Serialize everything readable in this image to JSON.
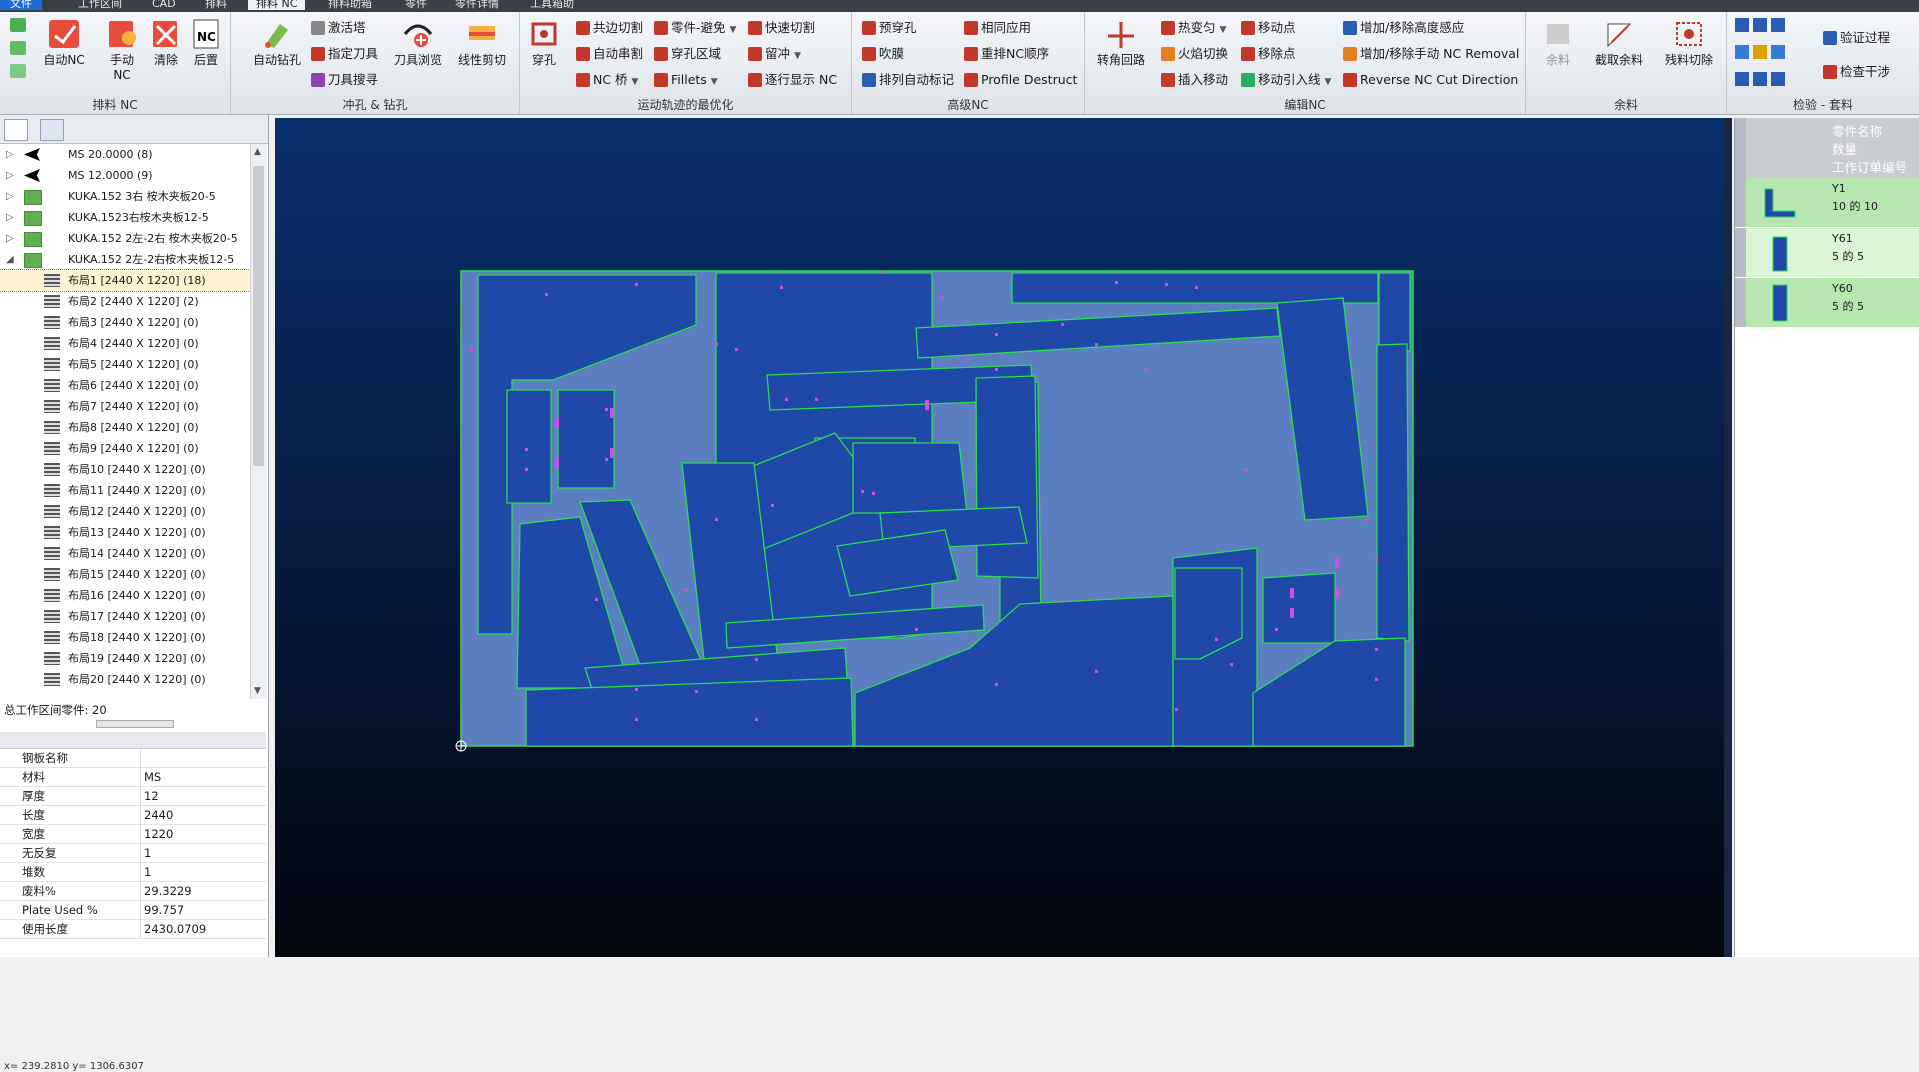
{
  "menu": {
    "tabs": [
      "文件",
      "工作区间",
      "CAD",
      "排料",
      "排料 NC",
      "排料助箱",
      "零件",
      "零件详情",
      "工具箱助"
    ]
  },
  "ribbon": {
    "groups": {
      "nest_nc": "排料 NC",
      "punch_drill": "冲孔 & 钻孔",
      "motion": "运动轨迹的最优化",
      "advanced": "高级NC",
      "edit": "编辑NC",
      "remnant": "余料",
      "verify": "检验 - 套料"
    },
    "auto_nc": "自动NC",
    "manual_nc": "手动\nNC",
    "clear": "清除",
    "post": "后置",
    "auto_drill": "自动钻孔",
    "activate_turret": "激活塔",
    "assign_tool": "指定刀具",
    "tool_search": "刀具搜寻",
    "tool_browse": "刀具浏览",
    "line_shear": "线性剪切",
    "pierce": "穿孔",
    "common_cut": "共边切割",
    "auto_chain": "自动串割",
    "nc_bridge": "NC 桥",
    "part_avoid": "零件-避免",
    "pierce_zone": "穿孔区域",
    "fillets": "Fillets",
    "fast_cut": "快速切割",
    "micro_joint": "留冲",
    "show_path": "逐行显示 NC",
    "pre_pierce": "预穿孔",
    "blow": "吹膜",
    "auto_mark": "排列自动标记",
    "same_apply": "相同应用",
    "reorder": "重排NC顺序",
    "profile_destruct": "Profile Destruct",
    "corner_loop": "转角回路",
    "hot_change": "热变匀",
    "flame_switch": "火焰切换",
    "insert_move": "插入移动",
    "move_point": "移动点",
    "remove_point": "移除点",
    "move_lead": "移动引入线",
    "height_sense": "增加/移除高度感应",
    "manual_removal": "增加/移除手动 NC Removal",
    "reverse_cut": "Reverse NC Cut Direction",
    "remnant": "余料",
    "cut_remnant": "截取余料",
    "remnant_cut": "残料切除",
    "verify_process": "验证过程",
    "check_interference": "检查干涉"
  },
  "tree": {
    "nodes": [
      {
        "label": "MS 20.0000 (8)",
        "kind": "material"
      },
      {
        "label": "MS 12.0000 (9)",
        "kind": "material"
      },
      {
        "label": "KUKA.152 3右 桉木夹板20-5",
        "kind": "sheet"
      },
      {
        "label": "KUKA.1523右桉木夹板12-5",
        "kind": "sheet"
      },
      {
        "label": "KUKA.152 2左-2右 桉木夹板20-5",
        "kind": "sheet"
      },
      {
        "label": "KUKA.152 2左-2右桉木夹板12-5",
        "kind": "sheet"
      }
    ],
    "layouts": [
      "布局1 [2440 X 1220] (18)",
      "布局2 [2440 X 1220] (2)",
      "布局3 [2440 X 1220] (0)",
      "布局4 [2440 X 1220] (0)",
      "布局5 [2440 X 1220] (0)",
      "布局6 [2440 X 1220] (0)",
      "布局7 [2440 X 1220] (0)",
      "布局8 [2440 X 1220] (0)",
      "布局9 [2440 X 1220] (0)",
      "布局10 [2440 X 1220] (0)",
      "布局11 [2440 X 1220] (0)",
      "布局12 [2440 X 1220] (0)",
      "布局13 [2440 X 1220] (0)",
      "布局14 [2440 X 1220] (0)",
      "布局15 [2440 X 1220] (0)",
      "布局16 [2440 X 1220] (0)",
      "布局17 [2440 X 1220] (0)",
      "布局18 [2440 X 1220] (0)",
      "布局19 [2440 X 1220] (0)",
      "布局20 [2440 X 1220] (0)"
    ]
  },
  "total_parts": "总工作区间零件: 20",
  "properties": [
    {
      "key": "钢板名称",
      "value": ""
    },
    {
      "key": "材料",
      "value": "MS"
    },
    {
      "key": "厚度",
      "value": "12"
    },
    {
      "key": "长度",
      "value": "2440"
    },
    {
      "key": "宽度",
      "value": "1220"
    },
    {
      "key": "无反复",
      "value": "1"
    },
    {
      "key": "堆数",
      "value": "1"
    },
    {
      "key": "废料%",
      "value": "29.3229"
    },
    {
      "key": "Plate Used %",
      "value": "99.757"
    },
    {
      "key": "使用长度",
      "value": "2430.0709"
    }
  ],
  "status_coords": "x= 239.2810 y= 1306.6307",
  "parts_panel": {
    "headers": [
      "零件名称",
      "数量",
      "工作订单编号"
    ],
    "parts": [
      {
        "name": "Y1",
        "qty": "10 的 10"
      },
      {
        "name": "Y61",
        "qty": "5 的 5"
      },
      {
        "name": "Y60",
        "qty": "5 的 5"
      }
    ]
  },
  "colors": {
    "plate": "#5b7fc0",
    "part_fill": "#1f48a8",
    "part_edge": "#2ddc52",
    "hole": "#d24de0",
    "part_row": "#b7e6b0",
    "part_row_alt": "#d9f5d3"
  }
}
